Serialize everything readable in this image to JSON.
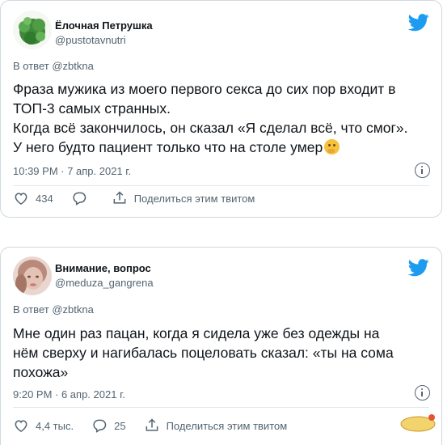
{
  "tweets": [
    {
      "author_name": "Ёлочная Петрушка",
      "handle": "@pustotavnutri",
      "reply_prefix": "В ответ",
      "reply_to": "@zbtkna",
      "lines": [
        "Фраза мужика из моего первого секса до сих пор входит в",
        "ТОП-3 самых странных.",
        "Когда всё закончилось, он сказал «Я сделал всё, что смог».",
        "У него будто пациент только что на столе умер"
      ],
      "emoji": "thinking-face-emoji",
      "timestamp": "10:39 PM · 7 апр. 2021 г.",
      "likes": "434",
      "replies": "",
      "share_label": "Поделиться этим твитом"
    },
    {
      "author_name": "Внимание, вопрос",
      "handle": "@meduza_gangrena",
      "reply_prefix": "В ответ",
      "reply_to": "@zbtkna",
      "lines": [
        "Мне один раз пацан, когда я сидела уже без одежды на",
        "нём сверху и нагибалась поцеловать сказал: «ты на сома",
        "похожа»"
      ],
      "timestamp": "9:20 PM · 6 апр. 2021 г.",
      "likes": "4,4 тыс.",
      "replies": "25",
      "share_label": "Поделиться этим твитом"
    }
  ],
  "colors": {
    "twitter_blue": "#1d9bf0",
    "text_primary": "#0f1419",
    "text_secondary": "#536471",
    "border": "#cfd9de"
  },
  "watermark": "fishki.net"
}
